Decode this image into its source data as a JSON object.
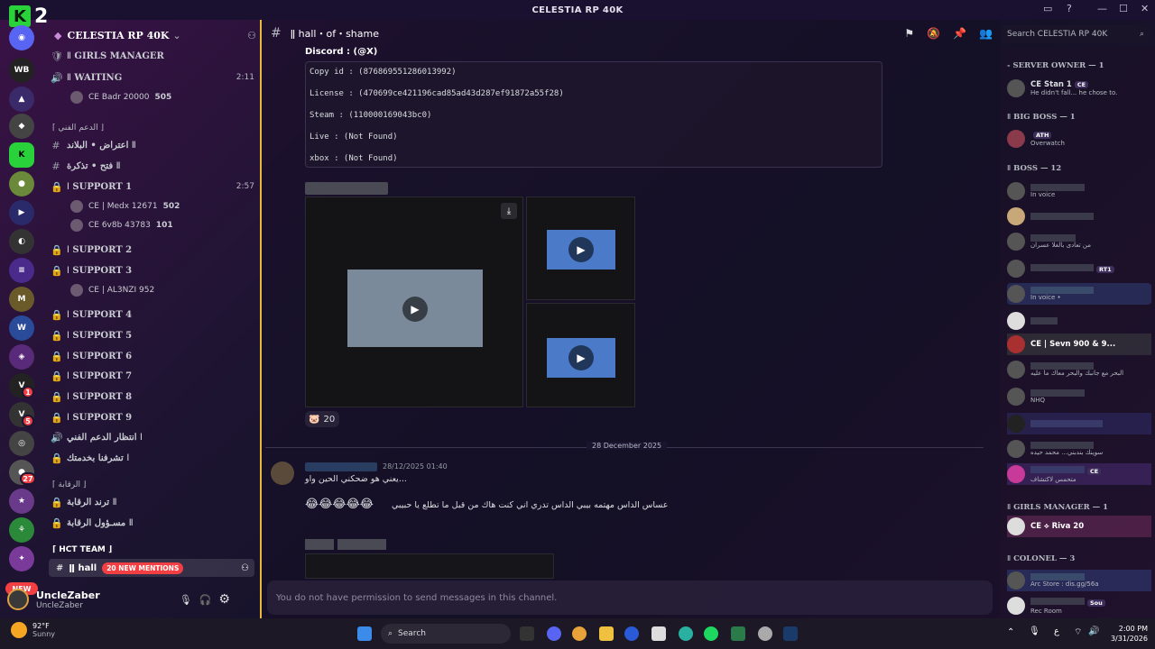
{
  "window": {
    "title": "CELESTIA RP 40K",
    "corner_digit": "2",
    "corner_letter": "K"
  },
  "server": {
    "name": "CELESTIA RP 40K"
  },
  "rail": {
    "badges": [
      "1",
      "5",
      "27"
    ],
    "new_label": "NEW"
  },
  "channels": [
    {
      "icon": "🛡",
      "name": "ǁ GIRLS MANAGER",
      "time": ""
    },
    {
      "icon": "🔊",
      "name": "ǁ WAITING",
      "time": "2:11"
    },
    {
      "icon": "#",
      "name": "اعتراض • البلاند ǁ",
      "time": ""
    },
    {
      "icon": "#",
      "name": "فتح • تذكرة ǁ",
      "time": ""
    },
    {
      "icon": "🔒",
      "name": "ǀ SUPPORT 1",
      "time": "2:57"
    },
    {
      "icon": "🔒",
      "name": "ǀ SUPPORT 2",
      "time": ""
    },
    {
      "icon": "🔒",
      "name": "ǀ SUPPORT 3",
      "time": ""
    },
    {
      "icon": "🔒",
      "name": "ǀ SUPPORT 4",
      "time": ""
    },
    {
      "icon": "🔒",
      "name": "ǀ SUPPORT 5",
      "time": ""
    },
    {
      "icon": "🔒",
      "name": "ǀ SUPPORT 6",
      "time": ""
    },
    {
      "icon": "🔒",
      "name": "ǀ SUPPORT 7",
      "time": ""
    },
    {
      "icon": "🔒",
      "name": "ǀ SUPPORT 8",
      "time": ""
    },
    {
      "icon": "🔒",
      "name": "ǀ SUPPORT 9",
      "time": ""
    },
    {
      "icon": "🔊",
      "name": "انتظار الدعم الفني ǀ",
      "time": ""
    },
    {
      "icon": "🔒",
      "name": "تشرفنا بخدمتك ǀ",
      "time": ""
    },
    {
      "icon": "🔒",
      "name": "ترند الرقابة ǁ",
      "time": ""
    },
    {
      "icon": "🔒",
      "name": "مسـؤول الرقابة ǁ",
      "time": ""
    }
  ],
  "voice_users": {
    "waiting": [
      {
        "name": "CE Badr 20000",
        "count": "505"
      }
    ],
    "support1": [
      {
        "name": "CE | Medx 12671",
        "count": "502"
      },
      {
        "name": "CE 6v8b 43783",
        "count": "101"
      }
    ],
    "support3": [
      {
        "name": "CE | AL3NZI 952",
        "count": ""
      }
    ]
  },
  "categories": [
    "⌈ الدعم الفني ⌋",
    "⌈ الرقابة ⌋",
    "⌈ HCT TEAM ⌋"
  ],
  "active_channel": {
    "name": "ǁ hall",
    "mentions": "20 NEW MENTIONS"
  },
  "user": {
    "display": "UncleZaber",
    "handle": "UncleZaber"
  },
  "header": {
    "channel": "ǁ hall・of・shame",
    "search_placeholder": "Search CELESTIA RP 40K"
  },
  "message1": {
    "discord_line": "Discord : (@X)",
    "code": [
      "Copy id : (876869551286013992)",
      "License : (470699ce421196cad85ad43d287ef91872a55f28)",
      "Steam : (110000169043bc0)",
      "Live : (Not Found)",
      "xbox : (Not Found)"
    ],
    "reaction_count": "20"
  },
  "date_divider": "28 December 2025",
  "message2": {
    "timestamp": "28/12/2025 01:40",
    "line1": "يعني هو ضحكني الحين واو...",
    "line2": "عساس الداس مهتمه بيبي الداس تدري اني كنت هاك من قبل ما تطلع يا حبيبي"
  },
  "input_placeholder": "You do not have permission to send messages in this channel.",
  "members": {
    "groups": [
      {
        "label": "- SERVER OWNER — 1"
      },
      {
        "label": "ǁ BIG BOSS — 1"
      },
      {
        "label": "ǁ BOSS — 12"
      },
      {
        "label": "ǁ GIRLS MANAGER — 1"
      },
      {
        "label": "ǁ COLONEL — 3"
      }
    ],
    "list": [
      {
        "name": "CE Stan 1",
        "tag": "CE",
        "status": "He didn't fall... he chose to."
      },
      {
        "name": "",
        "tag": "ATH",
        "status": "Overwatch"
      },
      {
        "name": "",
        "tag": "",
        "status": "In voice"
      },
      {
        "name": "",
        "tag": "",
        "status": ""
      },
      {
        "name": "",
        "tag": "",
        "status": "من تعادى بالغلا عسران"
      },
      {
        "name": "",
        "tag": "RT1",
        "status": ""
      },
      {
        "name": "",
        "tag": "",
        "status": "In voice •"
      },
      {
        "name": "",
        "tag": "",
        "status": ""
      },
      {
        "name": "CE | Sevn 900 & 9...",
        "tag": "",
        "status": ""
      },
      {
        "name": "",
        "tag": "",
        "status": "البحر مع جانبك والبحر معاك ما عليه"
      },
      {
        "name": "",
        "tag": "",
        "status": "NHQ"
      },
      {
        "name": "",
        "tag": "",
        "status": ""
      },
      {
        "name": "",
        "tag": "",
        "status": "سوينك بندبني... محمد حيده"
      },
      {
        "name": "",
        "tag": "CE",
        "status": "متحمس لاكتشاف"
      },
      {
        "name": "CE ⟡ Riva 20",
        "tag": "",
        "status": ""
      },
      {
        "name": "",
        "tag": "",
        "status": "Arc Store : dis.gg/56a"
      },
      {
        "name": "",
        "tag": "Sou",
        "status": "Rec Room"
      }
    ]
  },
  "taskbar": {
    "temp": "92°F",
    "weather": "Sunny",
    "search": "Search",
    "time": "2:00 PM",
    "date": "3/31/2026",
    "lang": "ع"
  }
}
